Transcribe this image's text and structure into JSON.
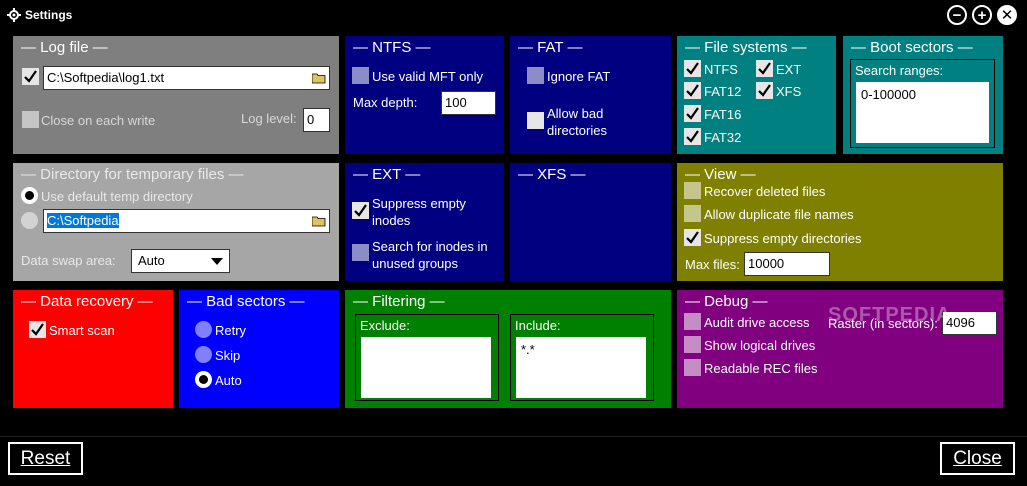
{
  "window": {
    "title": "Settings"
  },
  "log_file": {
    "title": "— Log file —",
    "enabled": true,
    "path": "C:\\Softpedia\\log1.txt",
    "close_each_write_label": "Close on each write",
    "close_each_write": false,
    "log_level_label": "Log level:",
    "log_level": "0"
  },
  "ntfs": {
    "title": "— NTFS —",
    "use_valid_mft_label": "Use valid MFT only",
    "use_valid_mft": false,
    "max_depth_label": "Max depth:",
    "max_depth": "100"
  },
  "fat": {
    "title": "— FAT —",
    "ignore_fat_label": "Ignore FAT",
    "ignore_fat": false,
    "allow_bad_dirs_label": "Allow bad directories",
    "allow_bad_dirs": false
  },
  "file_systems": {
    "title": "— File systems —",
    "items": [
      {
        "label": "NTFS",
        "checked": true
      },
      {
        "label": "EXT",
        "checked": true
      },
      {
        "label": "FAT12",
        "checked": true
      },
      {
        "label": "XFS",
        "checked": true
      },
      {
        "label": "FAT16",
        "checked": true
      },
      {
        "label": "FAT32",
        "checked": true
      }
    ]
  },
  "boot_sectors": {
    "title": "— Boot sectors —",
    "search_ranges_label": "Search ranges:",
    "search_ranges": "0-100000"
  },
  "temp_dir": {
    "title": "— Directory for temporary files —",
    "use_default_label": "Use default temp directory",
    "use_default": true,
    "path": "C:\\Softpedia",
    "swap_label": "Data swap area:",
    "swap_value": "Auto"
  },
  "ext": {
    "title": "— EXT —",
    "suppress_empty_label": "Suppress empty inodes",
    "suppress_empty": true,
    "search_unused_label": "Search for inodes in unused groups",
    "search_unused": false
  },
  "xfs": {
    "title": "— XFS —"
  },
  "view": {
    "title": "— View —",
    "recover_deleted_label": "Recover deleted files",
    "allow_duplicate_label": "Allow duplicate file names",
    "suppress_empty_dirs_label": "Suppress empty directories",
    "suppress_empty_dirs": true,
    "max_files_label": "Max files:",
    "max_files": "10000"
  },
  "data_recovery": {
    "title": "— Data recovery —",
    "smart_scan_label": "Smart scan",
    "smart_scan": true
  },
  "bad_sectors": {
    "title": "— Bad sectors —",
    "options": [
      "Retry",
      "Skip",
      "Auto"
    ],
    "selected": "Auto"
  },
  "filtering": {
    "title": "— Filtering —",
    "exclude_label": "Exclude:",
    "exclude_value": "",
    "include_label": "Include:",
    "include_value": "*.*"
  },
  "debug": {
    "title": "— Debug —",
    "audit_label": "Audit drive access",
    "logical_label": "Show logical drives",
    "readable_label": "Readable REC files",
    "raster_label": "Raster (in sectors):",
    "raster_value": "4096"
  },
  "watermark": "SOFTPEDIA",
  "buttons": {
    "reset": "Reset",
    "close": "Close"
  },
  "colors": {
    "gray": "#7f7f7f",
    "navy": "#000080",
    "teal": "#008080",
    "olive": "#808000",
    "red": "#ff0000",
    "blue": "#0000ff",
    "green": "#008000",
    "purple": "#800080"
  }
}
